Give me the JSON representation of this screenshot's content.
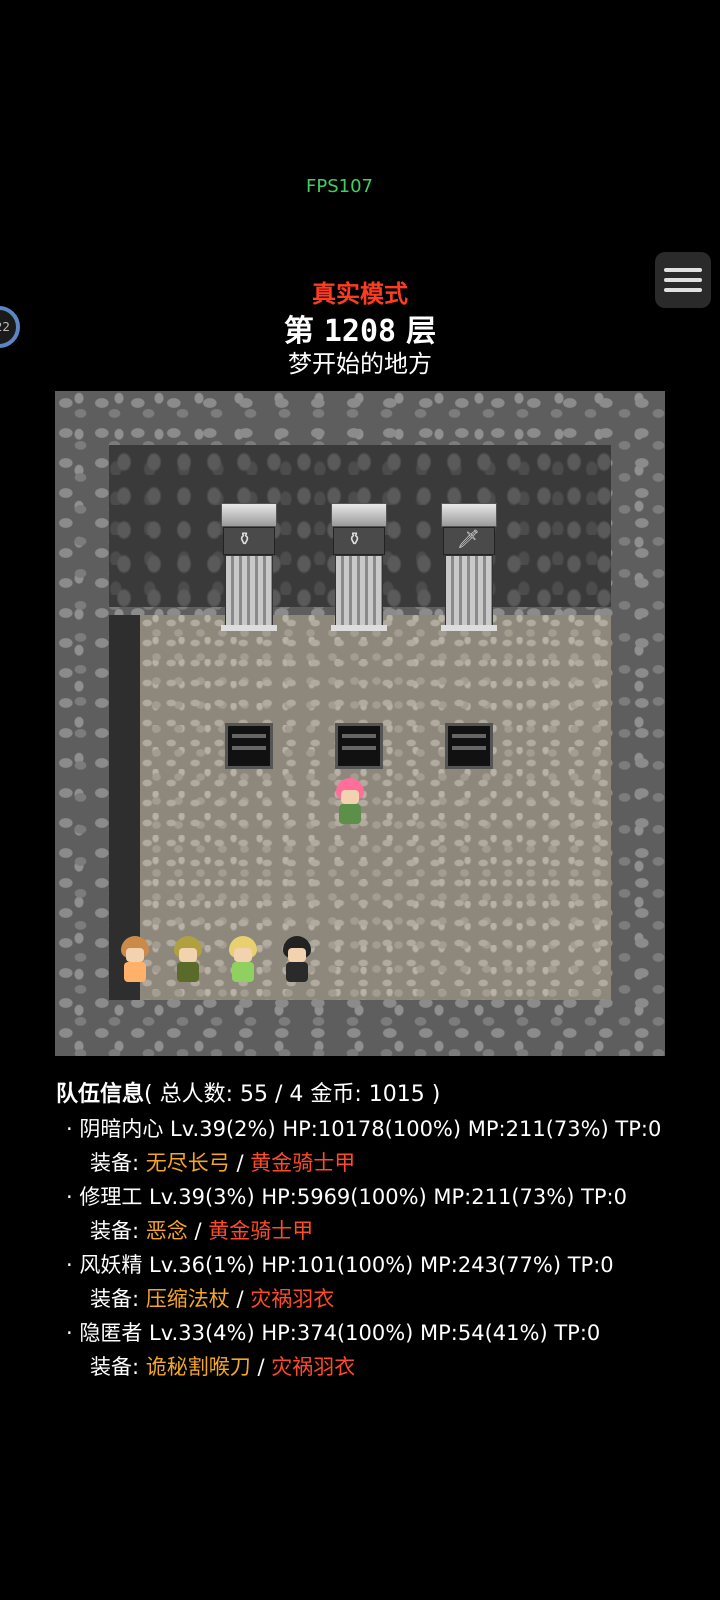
{
  "hud": {
    "fps": "FPS107",
    "side_badge": "22"
  },
  "header": {
    "mode": "真实模式",
    "floor_prefix": "第",
    "floor_number": "1208",
    "floor_suffix": "层",
    "floor_name": "梦开始的地方"
  },
  "map": {
    "pedestals": [
      {
        "item_icon": "potion-icon"
      },
      {
        "item_icon": "potion-icon"
      },
      {
        "item_icon": "sword-icon"
      }
    ],
    "stairs_count": 3,
    "player": {
      "hair_color": "#ff6f9a"
    },
    "party_sprites": [
      {
        "name": "阴暗内心",
        "hair_color": "#c98a4a",
        "body_color": "#ffb06a"
      },
      {
        "name": "修理工",
        "hair_color": "#b0a040",
        "body_color": "#5a6a2a"
      },
      {
        "name": "风妖精",
        "hair_color": "#e8d070",
        "body_color": "#90d060"
      },
      {
        "name": "隐匿者",
        "hair_color": "#222222",
        "body_color": "#2a2a2a"
      }
    ]
  },
  "party": {
    "title": "队伍信息",
    "summary": "( 总人数: 55 / 4 金币: 1015 )",
    "equip_label": "装备:",
    "separator": "/",
    "members": [
      {
        "name": "阴暗内心",
        "stats": "Lv.39(2%) HP:10178(100%) MP:211(73%) TP:0",
        "weapon": "无尽长弓",
        "armor": "黄金骑士甲"
      },
      {
        "name": "修理工",
        "stats": "Lv.39(3%) HP:5969(100%) MP:211(73%) TP:0",
        "weapon": "恶念",
        "armor": "黄金骑士甲"
      },
      {
        "name": "风妖精",
        "stats": "Lv.36(1%) HP:101(100%) MP:243(77%) TP:0",
        "weapon": "压缩法杖",
        "armor": "灾祸羽衣"
      },
      {
        "name": "隐匿者",
        "stats": "Lv.33(4%) HP:374(100%) MP:54(41%) TP:0",
        "weapon": "诡秘割喉刀",
        "armor": "灾祸羽衣"
      }
    ]
  },
  "colors": {
    "mode": "#ff3b22",
    "fps": "#3fd060",
    "weapon": "#f5a623",
    "armor": "#ff4a2a"
  }
}
